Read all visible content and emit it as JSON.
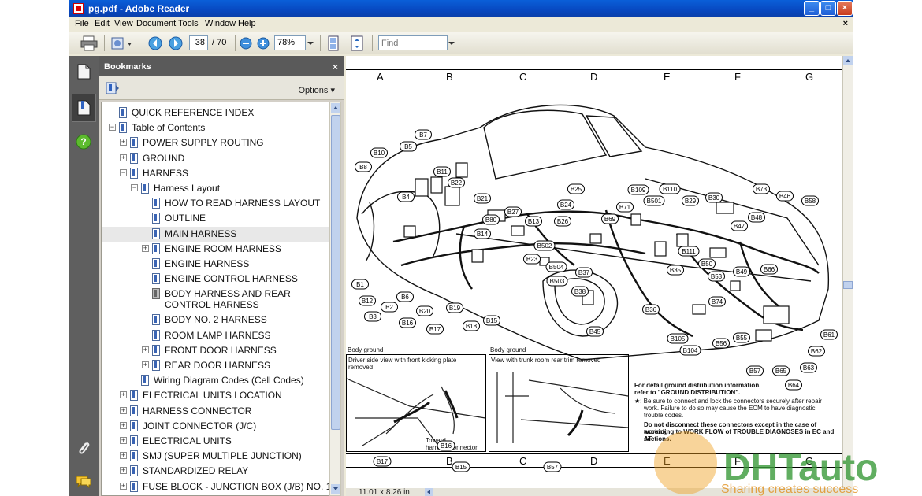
{
  "window": {
    "title": "pg.pdf - Adobe Reader",
    "close_doc": "×",
    "controls": {
      "minimize": "_",
      "maximize": "□",
      "close": "×"
    }
  },
  "menu": [
    "File",
    "Edit",
    "View",
    "Document",
    "Tools",
    "Window",
    "Help"
  ],
  "toolbar": {
    "page_number": "38",
    "page_total": "/ 70",
    "zoom": "78%",
    "find_placeholder": "Find"
  },
  "bookmarks": {
    "title": "Bookmarks",
    "close": "×",
    "options": "Options ▾",
    "items": [
      {
        "label": "QUICK REFERENCE INDEX",
        "level": 0,
        "expander": ""
      },
      {
        "label": "Table of Contents",
        "level": 0,
        "expander": "−"
      },
      {
        "label": "POWER SUPPLY ROUTING",
        "level": 1,
        "expander": "+"
      },
      {
        "label": "GROUND",
        "level": 1,
        "expander": "+"
      },
      {
        "label": "HARNESS",
        "level": 1,
        "expander": "−"
      },
      {
        "label": "Harness Layout",
        "level": 2,
        "expander": "−"
      },
      {
        "label": "HOW TO READ HARNESS LAYOUT",
        "level": 3,
        "expander": ""
      },
      {
        "label": "OUTLINE",
        "level": 3,
        "expander": ""
      },
      {
        "label": "MAIN HARNESS",
        "level": 3,
        "expander": "",
        "selected": true
      },
      {
        "label": "ENGINE ROOM HARNESS",
        "level": 3,
        "expander": "+"
      },
      {
        "label": "ENGINE HARNESS",
        "level": 3,
        "expander": ""
      },
      {
        "label": "ENGINE CONTROL HARNESS",
        "level": 3,
        "expander": ""
      },
      {
        "label": "BODY HARNESS AND REAR",
        "label2": "CONTROL HARNESS",
        "level": 3,
        "expander": "",
        "gray": true
      },
      {
        "label": "BODY NO. 2 HARNESS",
        "level": 3,
        "expander": ""
      },
      {
        "label": "ROOM LAMP HARNESS",
        "level": 3,
        "expander": ""
      },
      {
        "label": "FRONT DOOR HARNESS",
        "level": 3,
        "expander": "+"
      },
      {
        "label": "REAR DOOR HARNESS",
        "level": 3,
        "expander": "+"
      },
      {
        "label": "Wiring Diagram Codes (Cell Codes)",
        "level": 2,
        "expander": ""
      },
      {
        "label": "ELECTRICAL UNITS LOCATION",
        "level": 1,
        "expander": "+"
      },
      {
        "label": "HARNESS CONNECTOR",
        "level": 1,
        "expander": "+"
      },
      {
        "label": "JOINT CONNECTOR (J/C)",
        "level": 1,
        "expander": "+"
      },
      {
        "label": "ELECTRICAL UNITS",
        "level": 1,
        "expander": "+"
      },
      {
        "label": "SMJ (SUPER MULTIPLE JUNCTION)",
        "level": 1,
        "expander": "+"
      },
      {
        "label": "STANDARDIZED RELAY",
        "level": 1,
        "expander": "+"
      },
      {
        "label": "FUSE BLOCK - JUNCTION BOX (J/B) NO. 1",
        "level": 1,
        "expander": "+"
      }
    ]
  },
  "document": {
    "columns": [
      "A",
      "B",
      "C",
      "D",
      "E",
      "F",
      "G"
    ],
    "connectors": [
      "B1",
      "B2",
      "B3",
      "B4",
      "B5",
      "B6",
      "B7",
      "B8",
      "B10",
      "B11",
      "B12",
      "B13",
      "B14",
      "B15",
      "B16",
      "B17",
      "B18",
      "B19",
      "B20",
      "B21",
      "B22",
      "B23",
      "B24",
      "B25",
      "B26",
      "B27",
      "B29",
      "B30",
      "B35",
      "B36",
      "B37",
      "B38",
      "B45",
      "B46",
      "B47",
      "B48",
      "B49",
      "B50",
      "B53",
      "B55",
      "B56",
      "B57",
      "B58",
      "B61",
      "B62",
      "B63",
      "B64",
      "B65",
      "B66",
      "B69",
      "B71",
      "B73",
      "B74",
      "B80",
      "B104",
      "B105",
      "B109",
      "B110",
      "B111",
      "B501",
      "B502",
      "B503",
      "B504"
    ],
    "inset_left": {
      "heading": "Body ground",
      "caption1": "Driver side view with front kicking plate",
      "caption2": "removed",
      "labels": [
        "B16",
        "B17",
        "B15"
      ],
      "note1": "Toward",
      "note2": "harness connector"
    },
    "inset_right": {
      "heading": "Body ground",
      "caption": "View with trunk room rear trim removed",
      "labels": [
        "B57"
      ]
    },
    "notes": {
      "line1": "For detail ground distribution information,",
      "line2": "refer to \"GROUND DISTRIBUTION\".",
      "line3": "★: Be sure to connect and lock the connectors securely after repair",
      "line4": "work. Failure to do so may cause the ECM to have diagnostic",
      "line5": "trouble codes.",
      "line6": "Do not disconnect these connectors except in the case of working",
      "line7": "according to WORK FLOW of TROUBLE DIAGNOSES in EC and AT",
      "line8": "sections."
    },
    "page_size": "11.01 x 8.26 in"
  },
  "watermark": {
    "brand": "DHTauto",
    "tagline": "Sharing creates success"
  },
  "colors": {
    "titlebar": "#0a5fd8",
    "panel": "#5a5a5a",
    "watermark_green": "#3a9a3a",
    "watermark_orange": "#f0a020"
  }
}
